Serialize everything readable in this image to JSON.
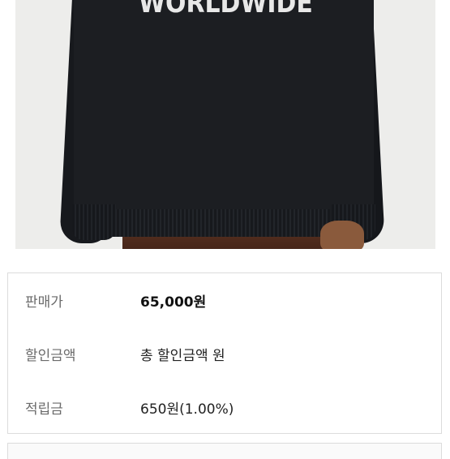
{
  "product_image": {
    "chest_print": "WORLDWIDE"
  },
  "price_info": {
    "rows": [
      {
        "label": "판매가",
        "value": "65,000원"
      },
      {
        "label": "할인금액",
        "value": "총 할인금액 원"
      },
      {
        "label": "적립금",
        "value": "650원(1.00%)"
      }
    ]
  }
}
